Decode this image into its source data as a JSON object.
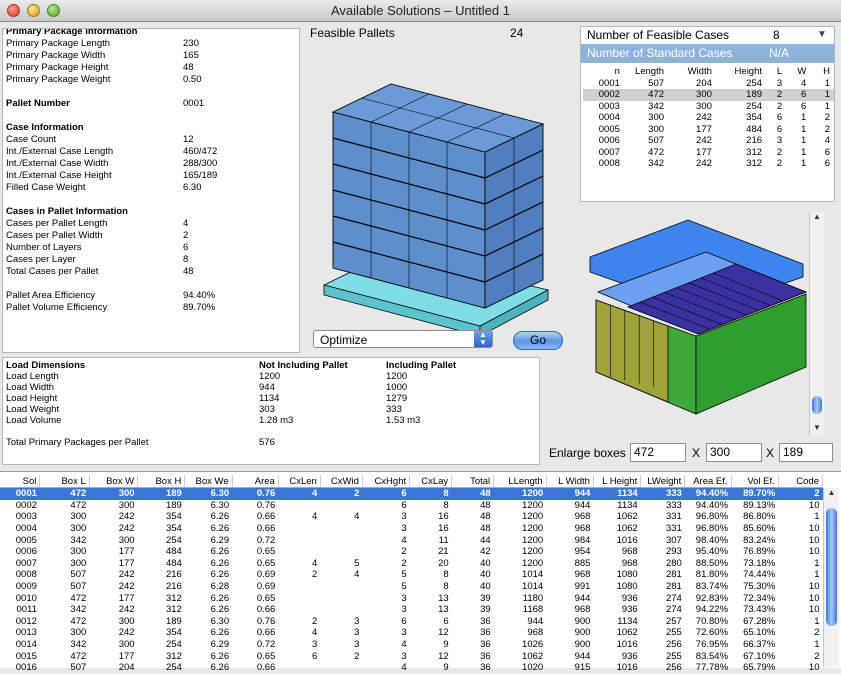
{
  "window": {
    "title": "Available Solutions – Untitled 1"
  },
  "info": {
    "s1_title": "Primary Package Information",
    "s1": [
      [
        "Primary Package Length",
        "230"
      ],
      [
        "Primary Package Width",
        "165"
      ],
      [
        "Primary Package Height",
        "48"
      ],
      [
        "Primary Package Weight",
        "0.50"
      ]
    ],
    "pallet_number_label": "Pallet Number",
    "pallet_number": "0001",
    "s2_title": "Case Information",
    "s2": [
      [
        "Case Count",
        "12"
      ],
      [
        "Int./External Case Length",
        "460/472"
      ],
      [
        "Int./External Case Width",
        "288/300"
      ],
      [
        "Int./External Case Height",
        "165/189"
      ],
      [
        "Filled Case Weight",
        "6.30"
      ]
    ],
    "s3_title": "Cases in Pallet Information",
    "s3": [
      [
        "Cases per Pallet Length",
        "4"
      ],
      [
        "Cases per Pallet Width",
        "2"
      ],
      [
        "Number of Layers",
        "6"
      ],
      [
        "Cases per Layer",
        "8"
      ],
      [
        "Total Cases per Pallet",
        "48"
      ]
    ],
    "s4": [
      [
        "Pallet Area Efficiency",
        "94.40%"
      ],
      [
        "Pallet Volume Efficiency",
        "89.70%"
      ]
    ]
  },
  "feasible": {
    "label": "Feasible Pallets",
    "value": "24"
  },
  "optimize": {
    "selected": "Optimize",
    "go_label": "Go"
  },
  "cases": {
    "feasible_label": "Number of Feasible Cases",
    "feasible_value": "8",
    "standard_label": "Number of Standard Cases",
    "standard_value": "N/A",
    "columns": [
      "n",
      "Length",
      "Width",
      "Height",
      "L",
      "W",
      "H"
    ],
    "rows": [
      [
        "0001",
        "507",
        "204",
        "254",
        "3",
        "4",
        "1"
      ],
      [
        "0002",
        "472",
        "300",
        "189",
        "2",
        "6",
        "1"
      ],
      [
        "0003",
        "342",
        "300",
        "254",
        "2",
        "6",
        "1"
      ],
      [
        "0004",
        "300",
        "242",
        "354",
        "6",
        "1",
        "2"
      ],
      [
        "0005",
        "300",
        "177",
        "484",
        "6",
        "1",
        "2"
      ],
      [
        "0006",
        "507",
        "242",
        "216",
        "3",
        "1",
        "4"
      ],
      [
        "0007",
        "472",
        "177",
        "312",
        "2",
        "1",
        "6"
      ],
      [
        "0008",
        "342",
        "242",
        "312",
        "2",
        "1",
        "6"
      ]
    ],
    "selected_row": 1
  },
  "load": {
    "title": "Load Dimensions",
    "col1": "Not Including Pallet",
    "col2": "Including Pallet",
    "rows": [
      [
        "Load Length",
        "1200",
        "1200"
      ],
      [
        "Load Width",
        "944",
        "1000"
      ],
      [
        "Load Height",
        "1134",
        "1279"
      ],
      [
        "Load Weight",
        "303",
        "333"
      ],
      [
        "Load Volume",
        "1.28 m3",
        "1.53 m3"
      ]
    ],
    "total_label": "Total Primary Packages per Pallet",
    "total_value": "576"
  },
  "enlarge": {
    "label": "Enlarge boxes",
    "x": "472",
    "sep1": "X",
    "y": "300",
    "sep2": "X",
    "z": "189"
  },
  "solutions": {
    "columns": [
      "Sol",
      "Box L",
      "Box W",
      "Box H",
      "Box We",
      "Area",
      "CxLen",
      "CxWid",
      "CxHght",
      "CxLay",
      "Total",
      "LLength",
      "L Width",
      "L Height",
      "LWeight",
      "Area Ef.",
      "Vol Ef.",
      "Code"
    ],
    "rows": [
      [
        "0001",
        "472",
        "300",
        "189",
        "6.30",
        "0.76",
        "4",
        "2",
        "6",
        "8",
        "48",
        "1200",
        "944",
        "1134",
        "333",
        "94.40%",
        "89.70%",
        "2"
      ],
      [
        "0002",
        "472",
        "300",
        "189",
        "6.30",
        "0.76",
        "",
        "",
        "6",
        "8",
        "48",
        "1200",
        "944",
        "1134",
        "333",
        "94.40%",
        "89.13%",
        "10"
      ],
      [
        "0003",
        "300",
        "242",
        "354",
        "6.26",
        "0.66",
        "4",
        "4",
        "3",
        "16",
        "48",
        "1200",
        "968",
        "1062",
        "331",
        "96.80%",
        "86.80%",
        "1"
      ],
      [
        "0004",
        "300",
        "242",
        "354",
        "6.26",
        "0.66",
        "",
        "",
        "3",
        "16",
        "48",
        "1200",
        "968",
        "1062",
        "331",
        "96.80%",
        "85.60%",
        "10"
      ],
      [
        "0005",
        "342",
        "300",
        "254",
        "6.29",
        "0.72",
        "",
        "",
        "4",
        "11",
        "44",
        "1200",
        "984",
        "1016",
        "307",
        "98.40%",
        "83.24%",
        "10"
      ],
      [
        "0006",
        "300",
        "177",
        "484",
        "6.26",
        "0.65",
        "",
        "",
        "2",
        "21",
        "42",
        "1200",
        "954",
        "968",
        "293",
        "95.40%",
        "76.89%",
        "10"
      ],
      [
        "0007",
        "300",
        "177",
        "484",
        "6.26",
        "0.65",
        "4",
        "5",
        "2",
        "20",
        "40",
        "1200",
        "885",
        "968",
        "280",
        "88.50%",
        "73.18%",
        "1"
      ],
      [
        "0008",
        "507",
        "242",
        "216",
        "6.26",
        "0.69",
        "2",
        "4",
        "5",
        "8",
        "40",
        "1014",
        "968",
        "1080",
        "281",
        "81.80%",
        "74.44%",
        "1"
      ],
      [
        "0009",
        "507",
        "242",
        "216",
        "6.28",
        "0.69",
        "",
        "",
        "5",
        "8",
        "40",
        "1014",
        "991",
        "1080",
        "281",
        "83.74%",
        "75.30%",
        "10"
      ],
      [
        "0010",
        "472",
        "177",
        "312",
        "6.26",
        "0.65",
        "",
        "",
        "3",
        "13",
        "39",
        "1180",
        "944",
        "936",
        "274",
        "92.83%",
        "72.34%",
        "10"
      ],
      [
        "0011",
        "342",
        "242",
        "312",
        "6.26",
        "0.66",
        "",
        "",
        "3",
        "13",
        "39",
        "1168",
        "968",
        "936",
        "274",
        "94.22%",
        "73.43%",
        "10"
      ],
      [
        "0012",
        "472",
        "300",
        "189",
        "6.30",
        "0.76",
        "2",
        "3",
        "6",
        "6",
        "36",
        "944",
        "900",
        "1134",
        "257",
        "70.80%",
        "67.28%",
        "1"
      ],
      [
        "0013",
        "300",
        "242",
        "354",
        "6.26",
        "0.66",
        "4",
        "3",
        "3",
        "12",
        "36",
        "968",
        "900",
        "1062",
        "255",
        "72.60%",
        "65.10%",
        "2"
      ],
      [
        "0014",
        "342",
        "300",
        "254",
        "6.29",
        "0.72",
        "3",
        "3",
        "4",
        "9",
        "36",
        "1026",
        "900",
        "1016",
        "256",
        "76.95%",
        "66.37%",
        "1"
      ],
      [
        "0015",
        "472",
        "177",
        "312",
        "6.26",
        "0.65",
        "6",
        "2",
        "3",
        "12",
        "36",
        "1062",
        "944",
        "936",
        "255",
        "83.54%",
        "67.10%",
        "2"
      ],
      [
        "0016",
        "507",
        "204",
        "254",
        "6.26",
        "0.66",
        "",
        "",
        "4",
        "9",
        "36",
        "1020",
        "915",
        "1016",
        "256",
        "77.78%",
        "65.79%",
        "10"
      ]
    ],
    "selected_row": 0
  }
}
